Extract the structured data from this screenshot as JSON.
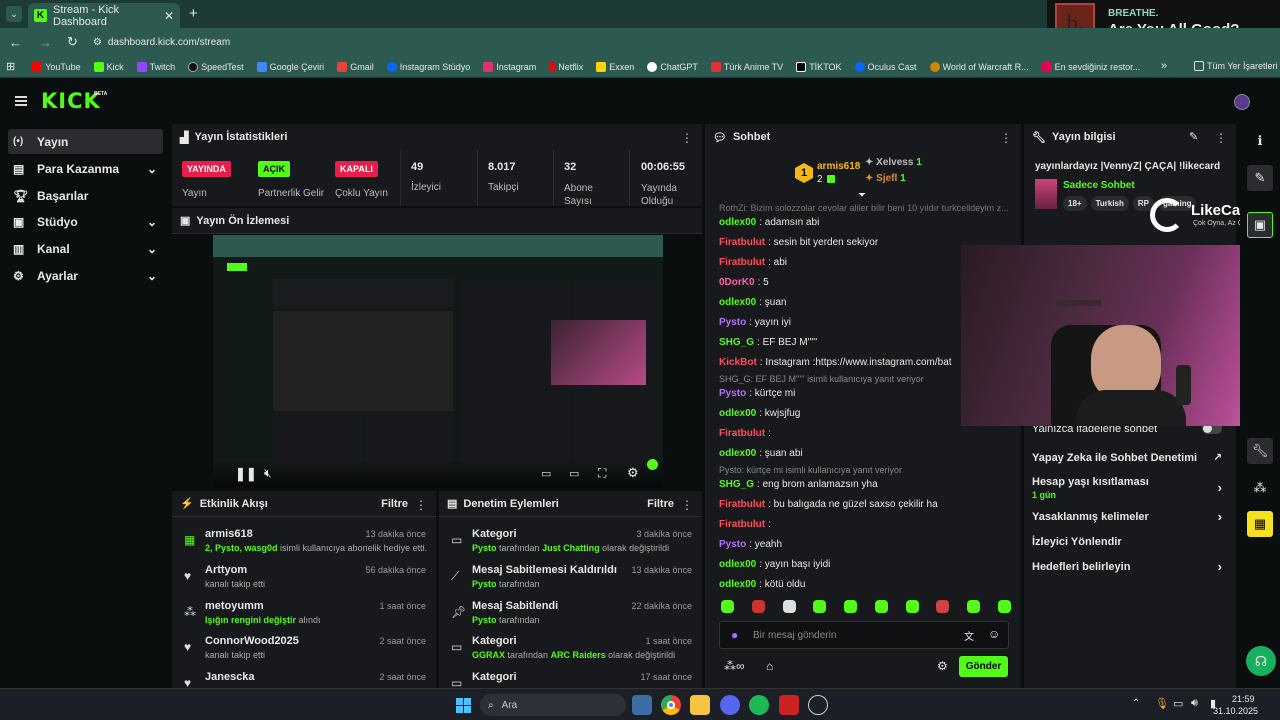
{
  "browser": {
    "tab_title": "Stream - Kick Dashboard",
    "url": "dashboard.kick.com/stream",
    "bookmarks": [
      "YouTube",
      "Kick",
      "Twitch",
      "SpeedTest",
      "Google Çeviri",
      "Gmail",
      "Instagram Stüdyo",
      "Instagram",
      "Netflix",
      "Exxen",
      "ChatGPT",
      "Türk Anime TV",
      "TİKTOK",
      "Oculus Cast",
      "World of Warcraft R...",
      "En sevdiğiniz restor..."
    ],
    "bookmark_folder": "Tüm Yer İşaretleri"
  },
  "ad": {
    "brand": "BREATHE.",
    "headline": "Are You All Good?"
  },
  "header": {
    "logo": "KICK",
    "logo_badge": "BETA"
  },
  "sidebar": {
    "items": [
      {
        "label": "Yayın",
        "icon": "broadcast-icon"
      },
      {
        "label": "Para Kazanma",
        "icon": "money-icon"
      },
      {
        "label": "Başarılar",
        "icon": "trophy-icon"
      },
      {
        "label": "Stüdyo",
        "icon": "studio-icon"
      },
      {
        "label": "Kanal",
        "icon": "channel-icon"
      },
      {
        "label": "Ayarlar",
        "icon": "gear-icon"
      }
    ]
  },
  "stats": {
    "title": "Yayın İstatistikleri",
    "items": [
      {
        "badge": "YAYINDA",
        "label": "Yayın",
        "color": "#e91d4b"
      },
      {
        "badge": "AÇIK",
        "label": "Partnerlik Gelir",
        "color": "#53fc18"
      },
      {
        "badge": "KAPALI",
        "label": "Çoklu Yayın",
        "color": "#e91d4b"
      },
      {
        "value": "49",
        "label": "İzleyici"
      },
      {
        "value": "8.017",
        "label": "Takipçi"
      },
      {
        "value": "32",
        "label": "Abone Sayısı"
      },
      {
        "value": "00:06:55",
        "label": "Yayında Olduğu"
      }
    ]
  },
  "preview": {
    "title": "Yayın Ön İzlemesi"
  },
  "activity": {
    "title": "Etkinlik Akışı",
    "filter": "Filtre",
    "rows": [
      {
        "name": "armis618",
        "sub_green": "2, Pysto, wasg0d",
        "sub": " isimli kullanıcıya abonelik hediye etti.",
        "time": "13 dakika önce",
        "icon": "gift-icon"
      },
      {
        "name": "Arttyom",
        "sub": "kanalı takip etti",
        "time": "56 dakika önce",
        "icon": "heart-icon"
      },
      {
        "name": "metoyumm",
        "sub_green": "Işığın rengini değiştir",
        "sub": " alındı",
        "time": "1 saat önce",
        "icon": "points-icon"
      },
      {
        "name": "ConnorWood2025",
        "sub": "kanalı takip etti",
        "time": "2 saat önce",
        "icon": "heart-icon"
      },
      {
        "name": "Janescka",
        "sub": "",
        "time": "2 saat önce",
        "icon": "heart-icon"
      }
    ]
  },
  "moderation": {
    "title": "Denetim Eylemleri",
    "filter": "Filtre",
    "rows": [
      {
        "name": "Kategori",
        "sub_user": "Pysto",
        "sub": " tarafından ",
        "sub_green2": "Just Chatting",
        "sub2": " olarak değiştirildi",
        "time": "3 dakika önce",
        "icon": "category-icon"
      },
      {
        "name": "Mesaj Sabitlemesi Kaldırıldı",
        "sub_user": "Pysto",
        "sub": " tarafından",
        "time": "13 dakika önce",
        "icon": "unpin-icon"
      },
      {
        "name": "Mesaj Sabitlendi",
        "sub_user": "Pysto",
        "sub": " tarafından",
        "time": "22 dakika önce",
        "icon": "pin-icon"
      },
      {
        "name": "Kategori",
        "sub_user": "GGRAX",
        "sub": " tarafından ",
        "sub_green2": "ARC Raiders",
        "sub2": " olarak değiştirildi",
        "time": "1 saat önce",
        "icon": "category-icon"
      },
      {
        "name": "Kategori",
        "sub_user": "",
        "sub": "",
        "time": "17 saat önce",
        "icon": "category-icon"
      }
    ]
  },
  "chat": {
    "title": "Sohbet",
    "top_gifter": {
      "name": "armis618",
      "count": "2"
    },
    "gifters": [
      {
        "name": "Xelvess",
        "count": "1"
      },
      {
        "name": "Sjefl",
        "count": "1"
      }
    ],
    "truncated": "RothZi: Bizim solozzolar cevolar aliler bilir beni 10 yıldır turkcelldeyim z...",
    "lines": [
      {
        "user": "odlex00",
        "text": ": adamsın abi",
        "color": "#53fc18"
      },
      {
        "user": "Firatbulut",
        "text": ": sesin bit yerden sekiyor",
        "color": "#ff4e5d"
      },
      {
        "user": "Firatbulut",
        "text": ": abi",
        "color": "#ff4e5d"
      },
      {
        "user": "0DorK0",
        "text": ": 5",
        "color": "#ff5ea8"
      },
      {
        "user": "odlex00",
        "text": ": şuan",
        "color": "#53fc18"
      },
      {
        "user": "Pysto",
        "text": ": yayın iyi",
        "color": "#b36cff"
      },
      {
        "user": "SHG_G",
        "text": ": EF BEJ M'''''",
        "color": "#53fc18"
      },
      {
        "user": "KickBot",
        "text": ": Instagram :https://www.instagram.com/bat",
        "color": "#ff4e5d"
      },
      {
        "reply": "SHG_G: EF BEJ M''''' isimli kullanıcıya yanıt veriyor"
      },
      {
        "user": "Pysto",
        "text": ": kürtçe mi",
        "color": "#b36cff"
      },
      {
        "user": "odlex00",
        "text": ": kwjsjfug",
        "color": "#53fc18"
      },
      {
        "user": "Firatbulut",
        "text": ":",
        "color": "#ff4e5d"
      },
      {
        "user": "odlex00",
        "text": ": şuan abi",
        "color": "#53fc18"
      },
      {
        "reply": "Pysto: kürtçe mi isimli kullanıcıya yanıt veriyor"
      },
      {
        "user": "SHG_G",
        "text": ": eng brom anlamazsın yha",
        "color": "#53fc18"
      },
      {
        "user": "Firatbulut",
        "text": ": bu balıgada ne güzel saxso çekilir ha",
        "color": "#ff4e5d"
      },
      {
        "user": "Firatbulut",
        "text": ":",
        "color": "#ff4e5d"
      },
      {
        "user": "Pysto",
        "text": ": yeahh",
        "color": "#b36cff"
      },
      {
        "user": "odlex00",
        "text": ": yayın başı iyidi",
        "color": "#53fc18"
      },
      {
        "user": "odlex00",
        "text": ": kötü oldu",
        "color": "#53fc18"
      }
    ],
    "placeholder": "Bir mesaj gönderin",
    "send": "Gönder"
  },
  "info": {
    "title": "Yayın bilgisi",
    "stream_title": "yayınlardayız |VennyZ| ÇAÇA| !likecard",
    "category": "Sadece Sohbet",
    "tags": [
      "18+",
      "Turkish",
      "RP",
      "gaming"
    ],
    "emote_only": "Yalnızca ifadelerle sohbet",
    "ai_mod": "Yapay Zeka ile Sohbet Denetimi",
    "account_age": "Hesap yaşı kısıtlaması",
    "account_age_val": "1 gün",
    "banned_words": "Yasaklanmış kelimeler",
    "redirect": "İzleyici Yönlendir",
    "goals": "Hedefleri belirleyin"
  },
  "overlay": {
    "brand": "LikeCard",
    "tagline": "Çok Oyna, Az Öde"
  },
  "taskbar": {
    "search": "Ara",
    "time": "21:59",
    "date": "31.10.2025"
  }
}
